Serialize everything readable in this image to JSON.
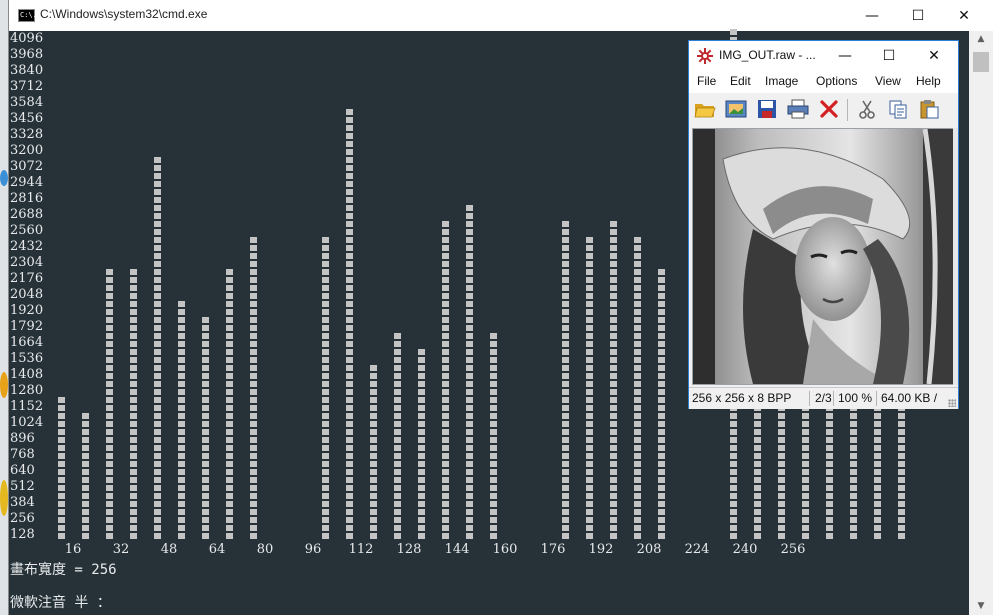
{
  "cmd": {
    "title": "C:\\Windows\\system32\\cmd.exe",
    "icon": "console-icon",
    "icon_text": "C:\\.",
    "controls": {
      "minimize": "—",
      "maximize": "☐",
      "close": "✕"
    },
    "scroll_up": "▲",
    "scroll_down": "▼"
  },
  "histogram": {
    "y_labels": [
      "4096",
      "3968",
      "3840",
      "3712",
      "3584",
      "3456",
      "3328",
      "3200",
      "3072",
      "2944",
      "2816",
      "2688",
      "2560",
      "2432",
      "2304",
      "2176",
      "2048",
      "1920",
      "1792",
      "1664",
      "1536",
      "1408",
      "1280",
      "1152",
      "1024",
      "896",
      "768",
      "640",
      "512",
      "384",
      "256",
      "128"
    ],
    "x_labels": [
      "16",
      "32",
      "48",
      "64",
      "80",
      "96",
      "112",
      "128",
      "144",
      "160",
      "176",
      "192",
      "208",
      "224",
      "240",
      "256"
    ]
  },
  "chart_data": {
    "type": "bar",
    "x": [
      4,
      8,
      12,
      16,
      20,
      24,
      28,
      32,
      36,
      40,
      44,
      48,
      52,
      56,
      60,
      64,
      68,
      72,
      76,
      80,
      84,
      88,
      92,
      96,
      100,
      104,
      108,
      112,
      116,
      120,
      124,
      128,
      132,
      136,
      140,
      144,
      148,
      152,
      156,
      160,
      164,
      168,
      172,
      176,
      180,
      184,
      188,
      192,
      196,
      200,
      204,
      208,
      212,
      216,
      220,
      224,
      228,
      232,
      236,
      240,
      244,
      248,
      252,
      256
    ],
    "values": [
      1152,
      1024,
      2176,
      2176,
      3072,
      1920,
      1792,
      2176,
      2432,
      0,
      0,
      2432,
      3456,
      1408,
      1664,
      1536,
      2560,
      2688,
      1664,
      0,
      0,
      2560,
      2432,
      2560,
      2432,
      2176,
      0,
      0,
      4096,
      1152,
      1152,
      1152,
      1152,
      1152,
      1152,
      1152
    ],
    "bar_positions_index": [
      2,
      3,
      4,
      5,
      6,
      7,
      8,
      9,
      10,
      11,
      12,
      13,
      14,
      15,
      16,
      17,
      18,
      19,
      20,
      21,
      22,
      23,
      24,
      25,
      26,
      27,
      28,
      29,
      30,
      31,
      32,
      33,
      34,
      35,
      36,
      37
    ],
    "ylim": [
      0,
      4096
    ],
    "xlabel": "",
    "ylabel": "",
    "grid": false,
    "bar_color": "#c4c4c4"
  },
  "console_lines": {
    "canvas_width": "畫布寬度 = 256",
    "ime_status": "微軟注音 半 ："
  },
  "viewer": {
    "title": "IMG_OUT.raw - ...",
    "controls": {
      "minimize": "—",
      "maximize": "☐",
      "close": "✕"
    },
    "menu": [
      "File",
      "Edit",
      "Image",
      "Options",
      "View",
      "Help"
    ],
    "toolbar": [
      "open-folder-icon",
      "slideshow-icon",
      "save-icon",
      "print-icon",
      "delete-icon",
      "cut-icon",
      "copy-icon",
      "paste-icon"
    ],
    "status": {
      "dimensions": "256 x 256 x 8 BPP",
      "index": "2/3",
      "zoom": "100 %",
      "size": "64.00 KB / "
    }
  }
}
